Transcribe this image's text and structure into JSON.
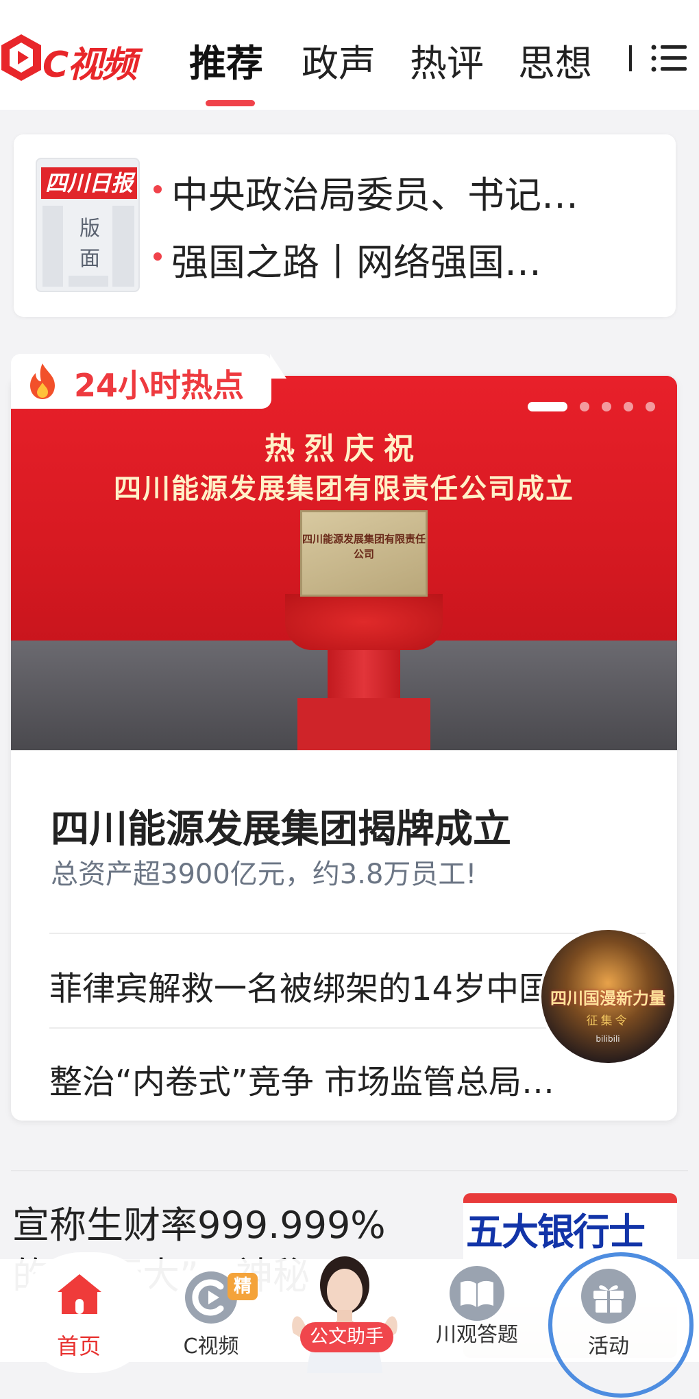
{
  "app": {
    "logo_text": "C视频",
    "brand_color": "#e8262a",
    "accent_color": "#f0424a"
  },
  "nav": {
    "tabs": [
      {
        "label": "推荐",
        "active": true
      },
      {
        "label": "政声",
        "active": false
      },
      {
        "label": "热评",
        "active": false
      },
      {
        "label": "思想",
        "active": false
      }
    ],
    "menu_icon": "list-menu-icon"
  },
  "newspaper": {
    "masthead": "四川日报",
    "label": "版面",
    "headlines": [
      "中央政治局委员、书记…",
      "强国之路丨网络强国…"
    ]
  },
  "hot": {
    "tag_title": "24小时热点",
    "tag_icon": "fire-icon",
    "banner": {
      "line1": "热烈庆祝",
      "line2": "四川能源发展集团有限责任公司成立",
      "plaque": "四川能源发展集团有限责任公司",
      "slide_count": 5,
      "active_slide": 1
    },
    "main_title": "四川能源发展集团揭牌成立",
    "main_subtitle": "总资产超3900亿元，约3.8万员工!",
    "items": [
      "菲律宾解救一名被绑架的14岁中国",
      "整治“内卷式”竞争 市场监管总局…"
    ]
  },
  "promo_badge": {
    "title": "四川国漫新力量",
    "subtitle": "征集令",
    "footer": "bilibili"
  },
  "feed": {
    "title": "宣称生财率999.999%的“银行大”…神秘",
    "thumb_text": "五大银行士"
  },
  "bottom_tabs": {
    "home": "首页",
    "cvideo": "C视频",
    "cvideo_badge": "精",
    "assistant": "公文助手",
    "quiz": "川观答题",
    "activity": "活动"
  }
}
